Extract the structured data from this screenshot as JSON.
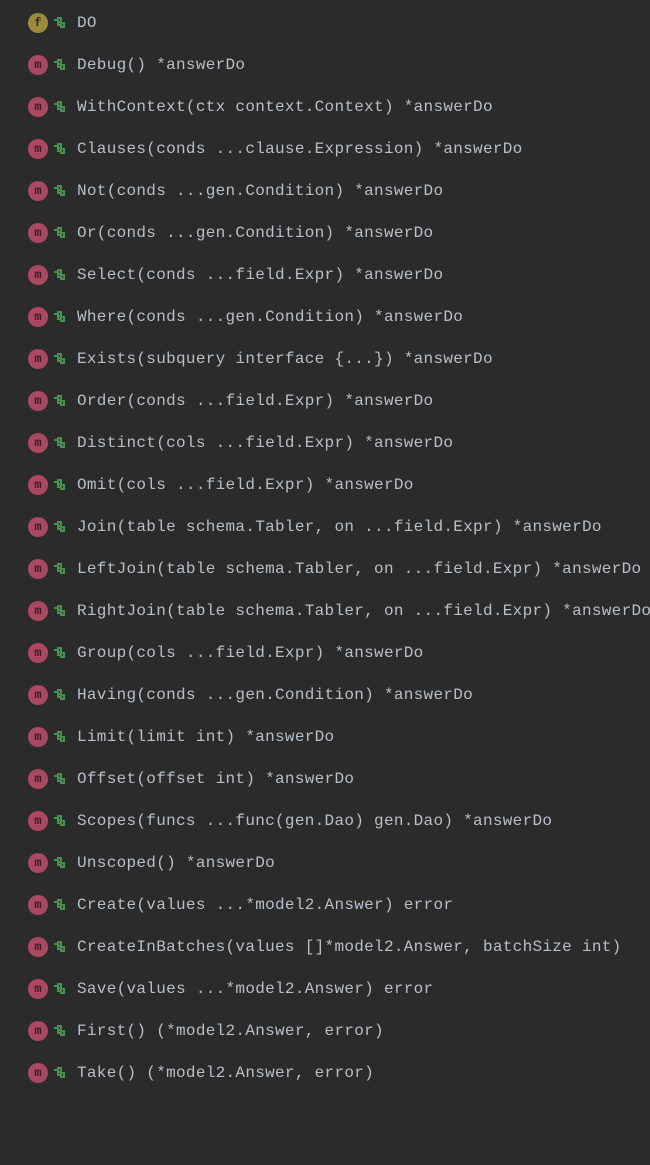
{
  "items": [
    {
      "kind": "f",
      "label": "DO"
    },
    {
      "kind": "m",
      "label": "Debug() *answerDo"
    },
    {
      "kind": "m",
      "label": "WithContext(ctx context.Context) *answerDo"
    },
    {
      "kind": "m",
      "label": "Clauses(conds ...clause.Expression) *answerDo"
    },
    {
      "kind": "m",
      "label": "Not(conds ...gen.Condition) *answerDo"
    },
    {
      "kind": "m",
      "label": "Or(conds ...gen.Condition) *answerDo"
    },
    {
      "kind": "m",
      "label": "Select(conds ...field.Expr) *answerDo"
    },
    {
      "kind": "m",
      "label": "Where(conds ...gen.Condition) *answerDo"
    },
    {
      "kind": "m",
      "label": "Exists(subquery interface {...}) *answerDo"
    },
    {
      "kind": "m",
      "label": "Order(conds ...field.Expr) *answerDo"
    },
    {
      "kind": "m",
      "label": "Distinct(cols ...field.Expr) *answerDo"
    },
    {
      "kind": "m",
      "label": "Omit(cols ...field.Expr) *answerDo"
    },
    {
      "kind": "m",
      "label": "Join(table schema.Tabler, on ...field.Expr) *answerDo"
    },
    {
      "kind": "m",
      "label": "LeftJoin(table schema.Tabler, on ...field.Expr) *answerDo"
    },
    {
      "kind": "m",
      "label": "RightJoin(table schema.Tabler, on ...field.Expr) *answerDo"
    },
    {
      "kind": "m",
      "label": "Group(cols ...field.Expr) *answerDo"
    },
    {
      "kind": "m",
      "label": "Having(conds ...gen.Condition) *answerDo"
    },
    {
      "kind": "m",
      "label": "Limit(limit int) *answerDo"
    },
    {
      "kind": "m",
      "label": "Offset(offset int) *answerDo"
    },
    {
      "kind": "m",
      "label": "Scopes(funcs ...func(gen.Dao) gen.Dao) *answerDo"
    },
    {
      "kind": "m",
      "label": "Unscoped() *answerDo"
    },
    {
      "kind": "m",
      "label": "Create(values ...*model2.Answer) error"
    },
    {
      "kind": "m",
      "label": "CreateInBatches(values []*model2.Answer, batchSize int)"
    },
    {
      "kind": "m",
      "label": "Save(values ...*model2.Answer) error"
    },
    {
      "kind": "m",
      "label": "First() (*model2.Answer, error)"
    },
    {
      "kind": "m",
      "label": "Take() (*model2.Answer, error)"
    }
  ]
}
